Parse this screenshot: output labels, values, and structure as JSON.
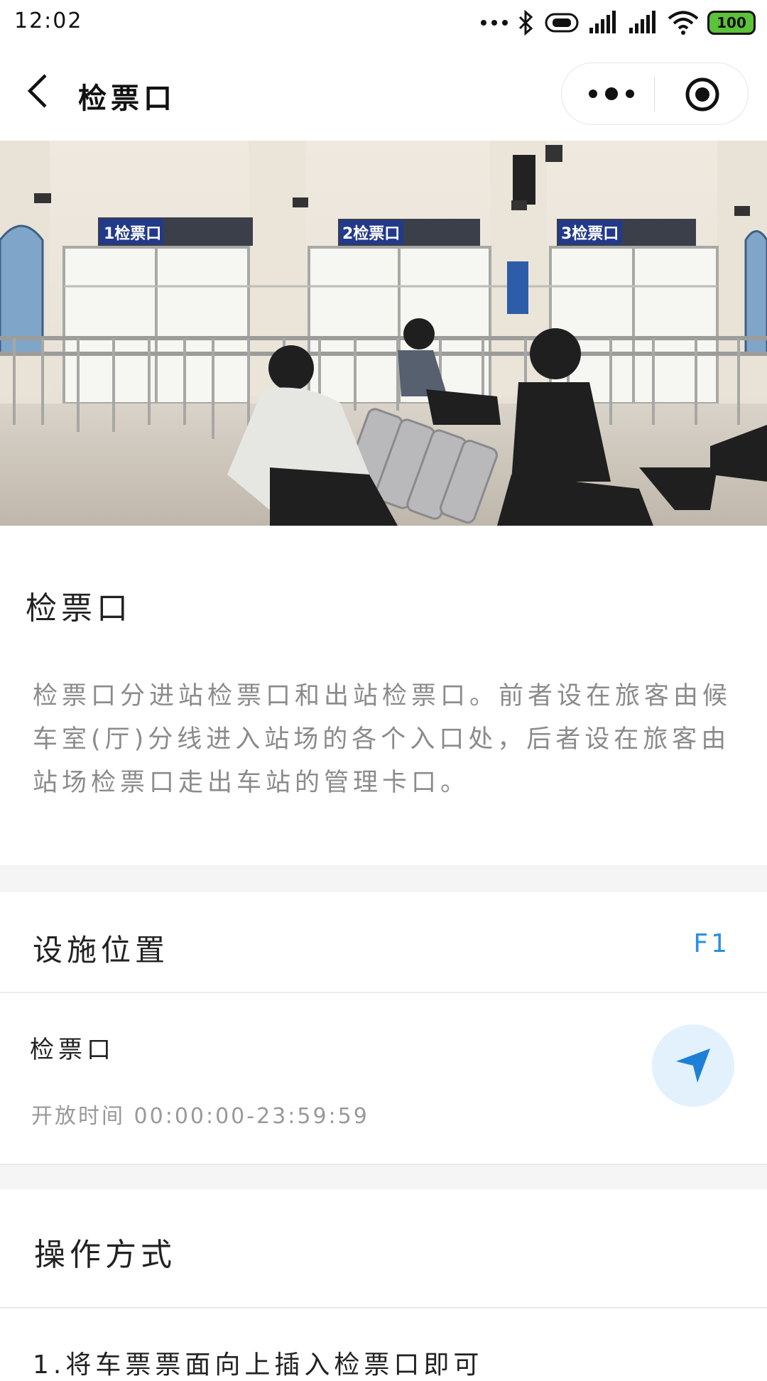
{
  "status_bar": {
    "time": "12:02",
    "battery": "100"
  },
  "nav": {
    "title": "检票口"
  },
  "content": {
    "title": "检票口",
    "description": "检票口分进站检票口和出站检票口。前者设在旅客由候车室(厅)分线进入站场的各个入口处，后者设在旅客由站场检票口走出车站的管理卡口。",
    "photo_gates": [
      "1检票口",
      "2检票口",
      "3检票口"
    ]
  },
  "location": {
    "section_title": "设施位置",
    "floor": "F1",
    "facility_name": "检票口",
    "open_hours": "开放时间 00:00:00-23:59:59"
  },
  "operation": {
    "section_title": "操作方式",
    "step1": "1.将车票票面向上插入检票口即可"
  },
  "colors": {
    "accent": "#2b8fe0",
    "nav_button_bg": "#e3f1fd",
    "battery": "#5cc23a"
  }
}
